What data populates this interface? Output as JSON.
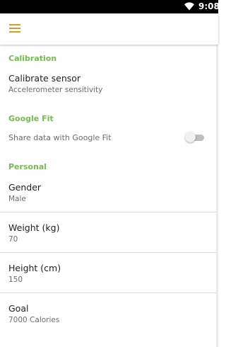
{
  "status_bar": {
    "time": "9:08",
    "wifi_icon": "wifi-icon"
  },
  "app_bar": {
    "menu_icon": "menu-icon"
  },
  "sections": {
    "calibration": {
      "header": "Calibration",
      "calibrate": {
        "title": "Calibrate sensor",
        "summary": "Accelerometer sensitivity"
      }
    },
    "google_fit": {
      "header": "Google Fit",
      "share": {
        "title": "Share data with Google Fit",
        "enabled": false
      }
    },
    "personal": {
      "header": "Personal",
      "gender": {
        "title": "Gender",
        "value": "Male"
      },
      "weight": {
        "title": "Weight (kg)",
        "value": "70"
      },
      "height": {
        "title": "Height (cm)",
        "value": "150"
      },
      "goal": {
        "title": "Goal",
        "value": "7000 Calories"
      }
    }
  },
  "colors": {
    "accent": "#6fbf4a",
    "menu_icon": "#c9a227",
    "status_bar": "#000000"
  }
}
